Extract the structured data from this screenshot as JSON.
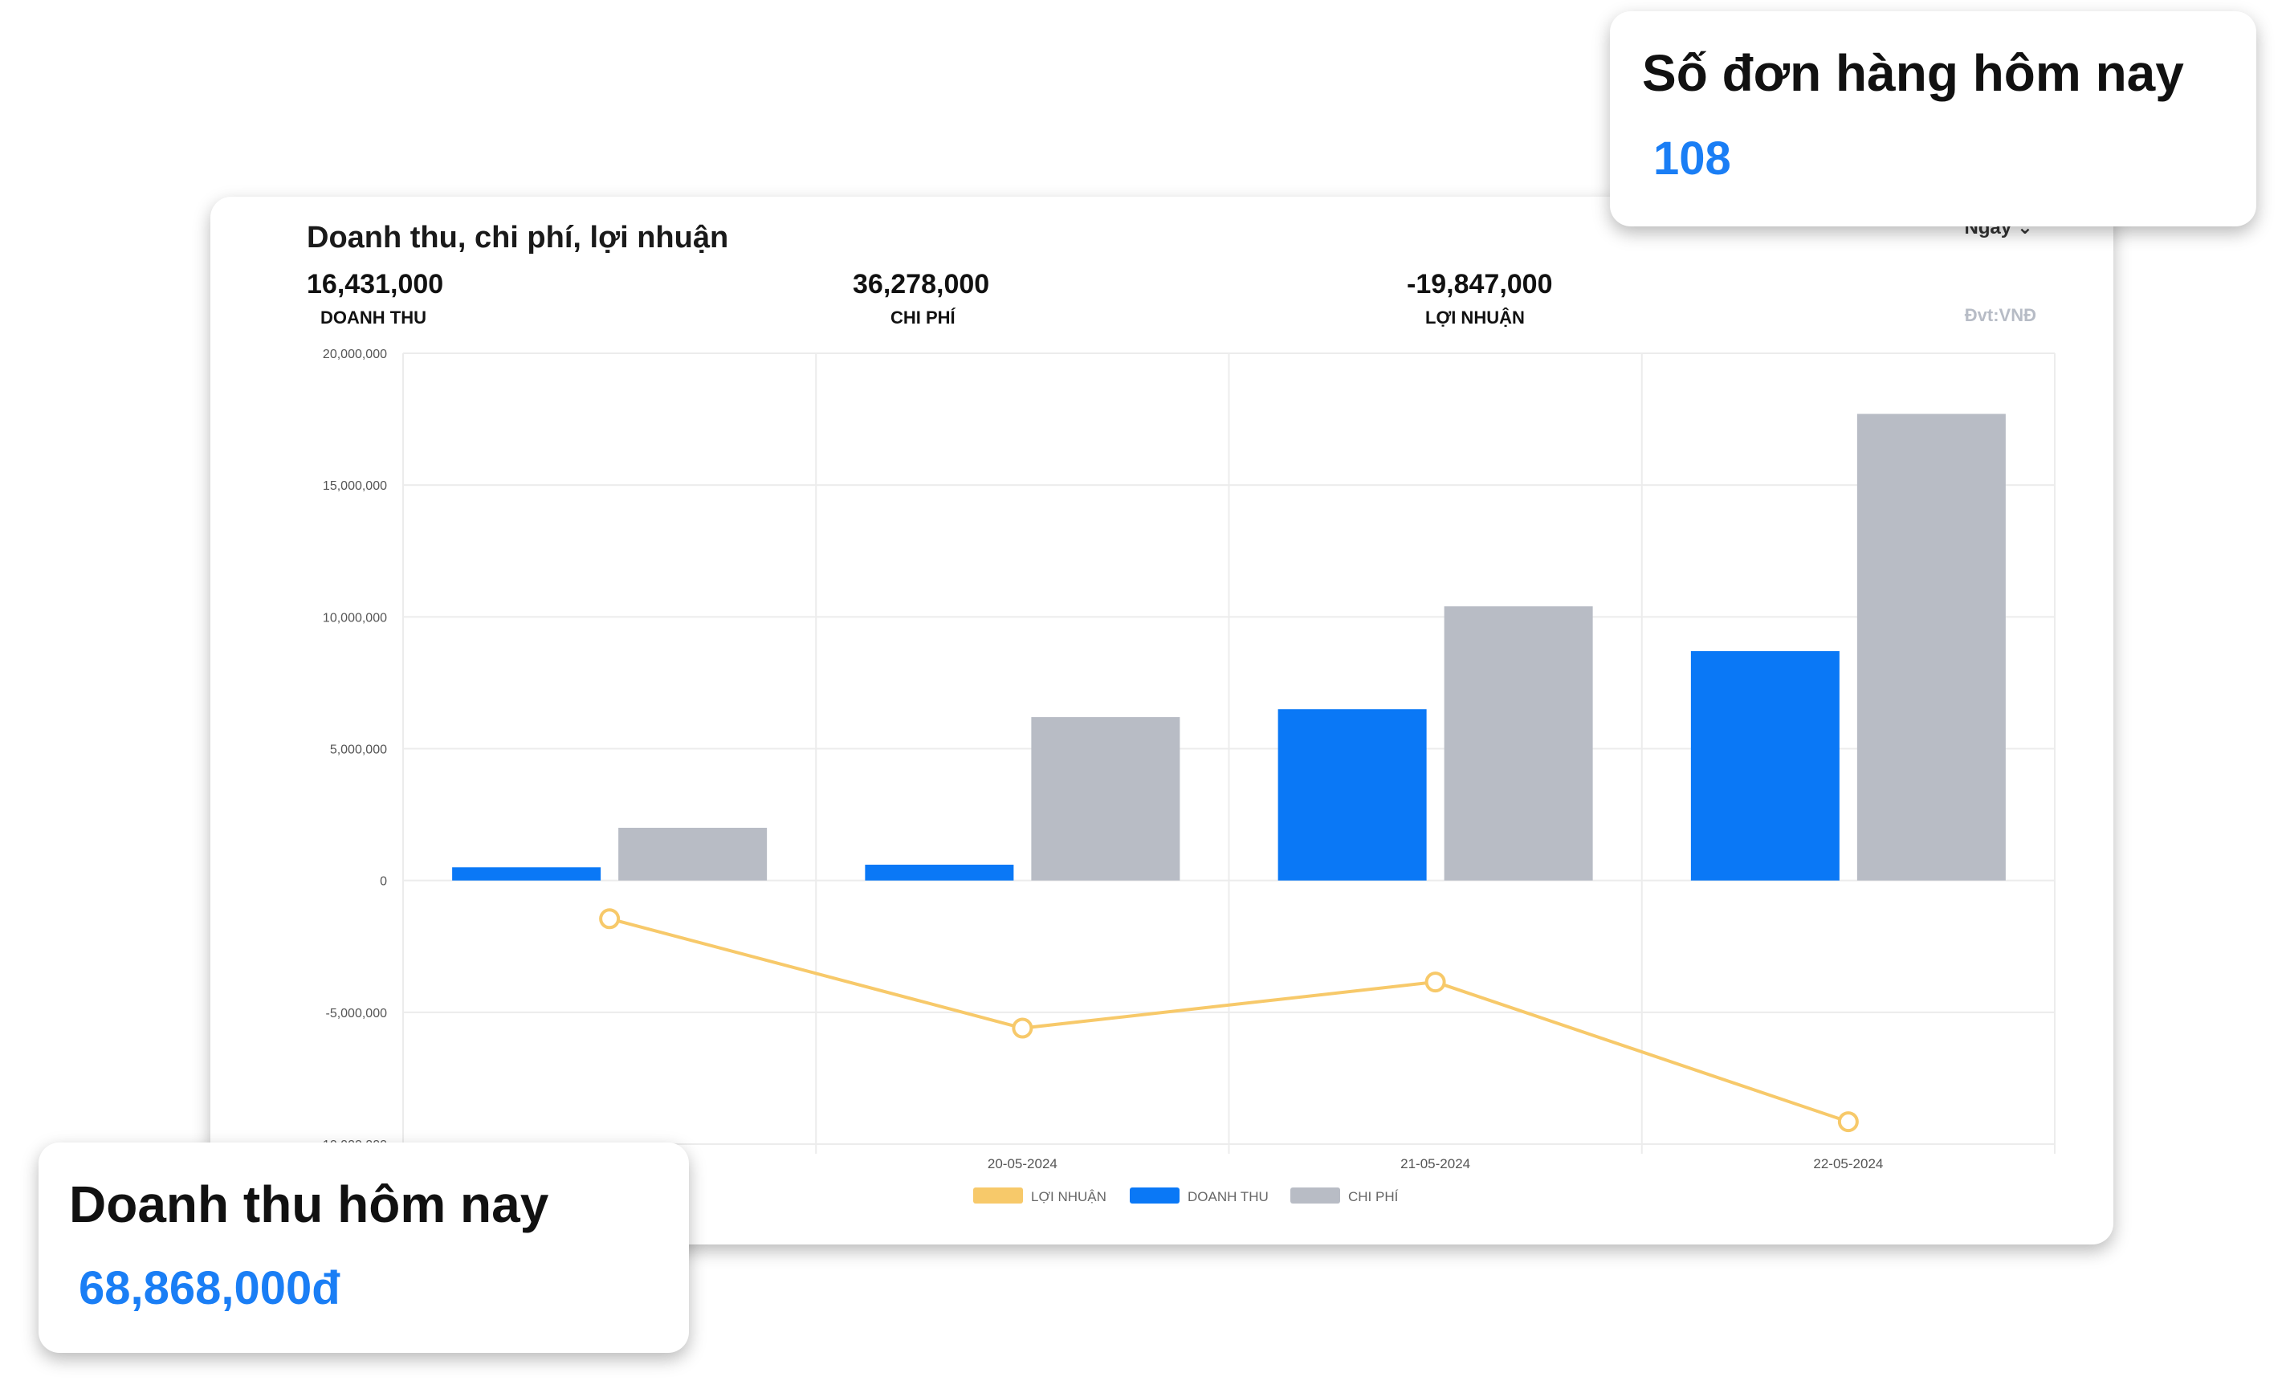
{
  "main_card": {
    "title": "Doanh thu, chi phí, lợi nhuận",
    "period_selector": "Ngày",
    "unit_note": "Đvt:VNĐ",
    "stats": [
      {
        "value": "16,431,000",
        "label": "DOANH THU"
      },
      {
        "value": "36,278,000",
        "label": "CHI PHÍ"
      },
      {
        "value": "-19,847,000",
        "label": "LỢI NHUẬN"
      }
    ]
  },
  "orders_card": {
    "title": "Số đơn hàng hôm nay",
    "value": "108"
  },
  "revenue_card": {
    "title": "Doanh thu hôm nay",
    "value": "68,868,000đ"
  },
  "chart_data": {
    "type": "bar",
    "title": "Doanh thu, chi phí, lợi nhuận",
    "categories": [
      "",
      "20-05-2024",
      "21-05-2024",
      "22-05-2024"
    ],
    "y_ticks": [
      "20,000,000",
      "15,000,000",
      "10,000,000",
      "5,000,000",
      "0",
      "-5,000,000",
      "-10,000,000"
    ],
    "ylim": [
      -10000000,
      20000000
    ],
    "grid": true,
    "legend_position": "bottom",
    "colors": {
      "revenue": "#0a78f6",
      "cost": "#b8bcc5",
      "profit": "#f7c96a"
    },
    "series": [
      {
        "name": "LỢI NHUẬN",
        "kind": "line",
        "values": [
          -1450000,
          -5600000,
          -3850000,
          -9150000
        ]
      },
      {
        "name": "DOANH THU",
        "kind": "bar",
        "values": [
          500000,
          600000,
          6500000,
          8700000
        ]
      },
      {
        "name": "CHI PHÍ",
        "kind": "bar",
        "values": [
          2000000,
          6200000,
          10400000,
          17700000
        ]
      }
    ]
  }
}
